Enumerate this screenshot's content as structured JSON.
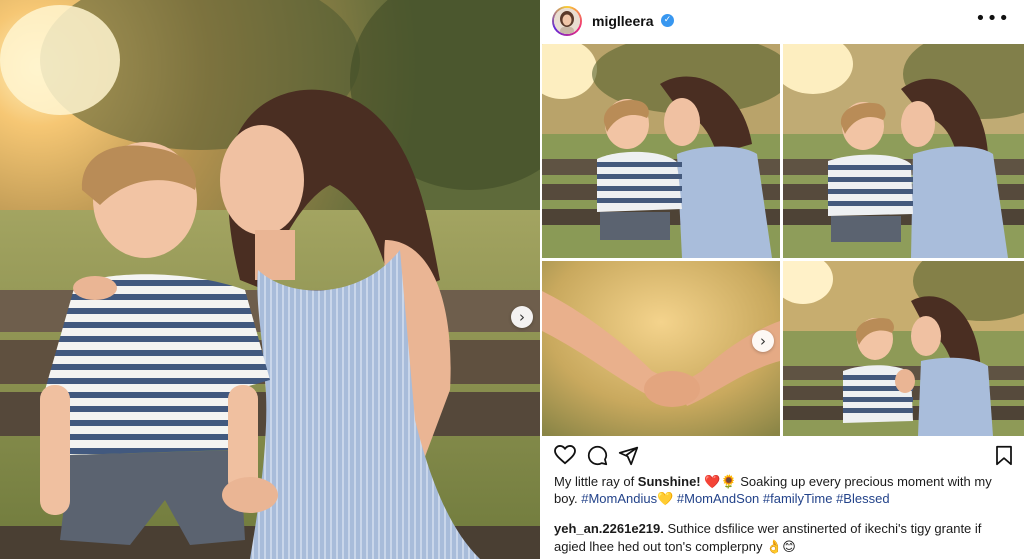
{
  "post": {
    "username": "miglleera",
    "verified_mark": "✓",
    "more_label": "•••",
    "next_arrow": "›"
  },
  "icons": [
    "heart-icon",
    "comment-icon",
    "share-icon",
    "bookmark-icon",
    "chevron-right-icon",
    "verified-icon",
    "more-options-icon"
  ],
  "caption": {
    "text": "My little ray of ",
    "bold": "Sunshine!",
    "emojis": "❤️🌻",
    "text2": " Soaking up every precious moment with my boy. ",
    "hashtags": "#MomAndius",
    "hashtag_emoji": "💛",
    "hashtags2": " #MomAndSon #familyTime #Blessed"
  },
  "comment": {
    "user": "yeh_an.2261e219.",
    "text": " Suthice dsfilice wer anstinerted of ikechi's tigy grante if agied lhee hed out ton's complerpny ",
    "emojis": "👌😊"
  },
  "colors": {
    "accent_link": "#23438a",
    "verified": "#3897f0",
    "heart": "#e0245e"
  }
}
